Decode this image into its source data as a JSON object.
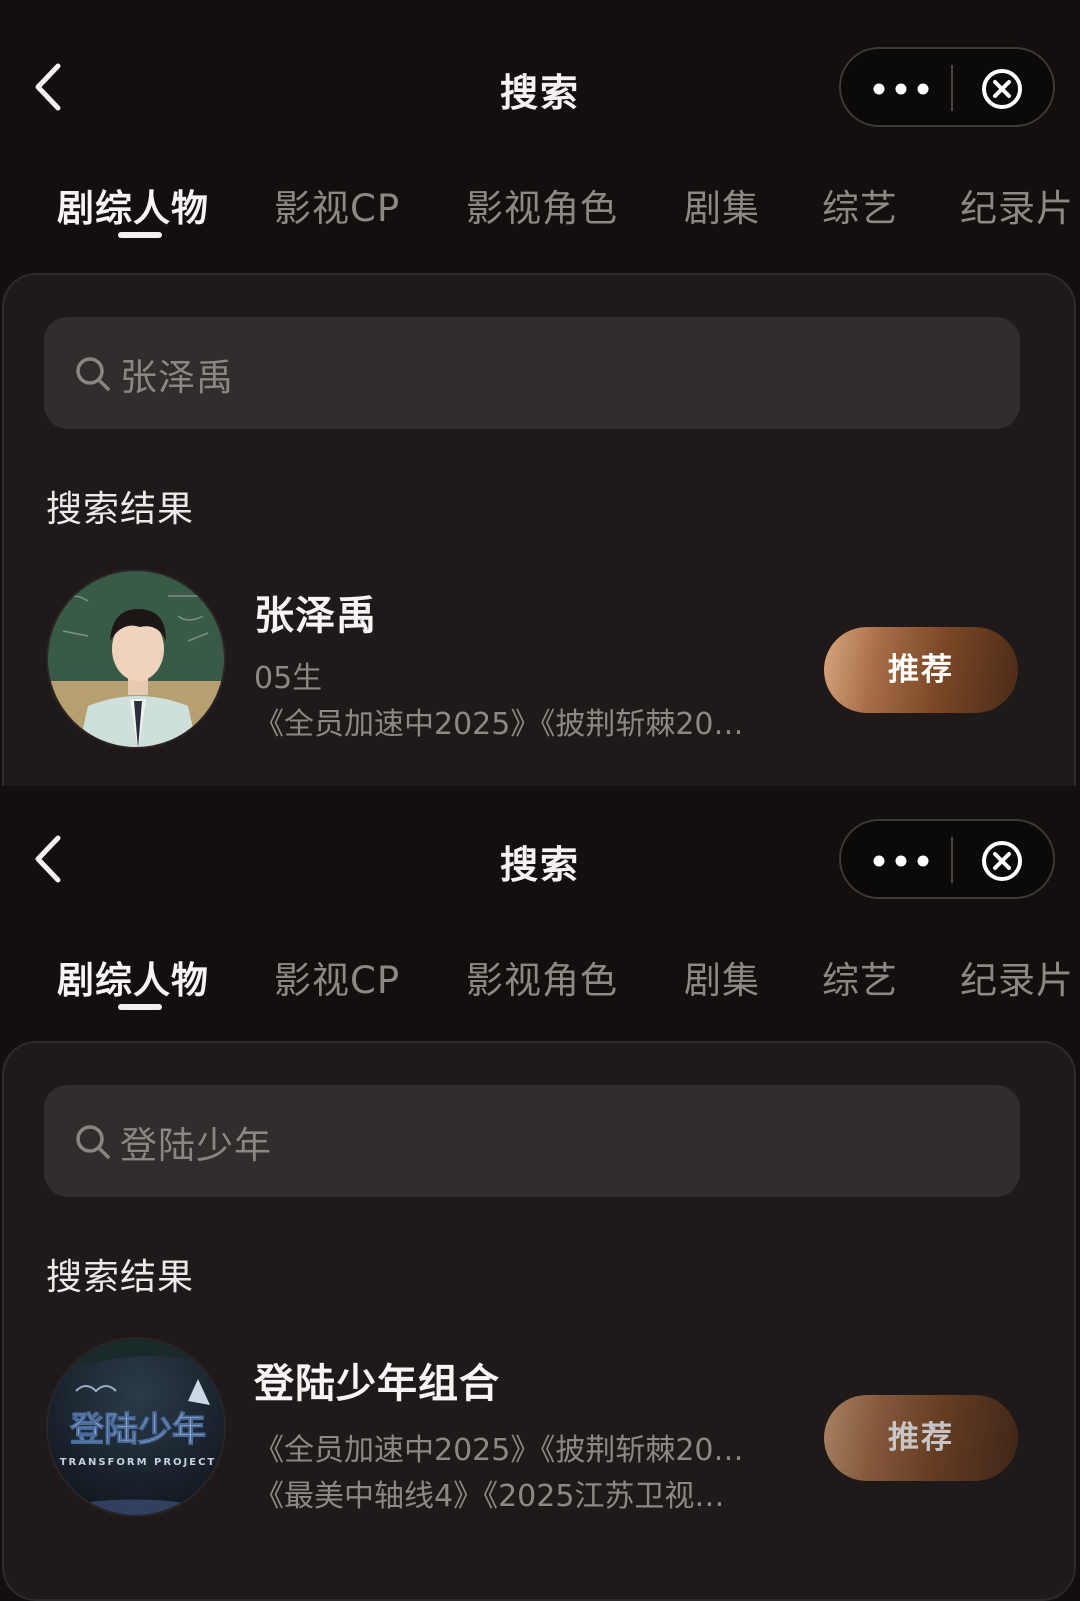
{
  "nav": {
    "title": "搜索",
    "back_icon": "chevron-left-icon",
    "more_icon": "more-dots-icon",
    "close_icon": "close-circle-icon"
  },
  "tabs": [
    {
      "label": "剧综人物",
      "active": true
    },
    {
      "label": "影视CP",
      "active": false
    },
    {
      "label": "影视角色",
      "active": false
    },
    {
      "label": "剧集",
      "active": false
    },
    {
      "label": "综艺",
      "active": false
    },
    {
      "label": "纪录片",
      "active": false
    }
  ],
  "colors": {
    "background": "#140f0f",
    "panel": "#1f1a19",
    "search_box": "#322d2c",
    "button_gradient_light": "#d8a67f",
    "button_gradient_dark": "#4a2a18"
  },
  "screens": [
    {
      "search": {
        "query": "张泽禹"
      },
      "section_label": "搜索结果",
      "result": {
        "name": "张泽禹",
        "line1": "05生",
        "line2": "《全员加速中2025》《披荆斩棘20…",
        "button": "推荐"
      }
    },
    {
      "search": {
        "query": "登陆少年"
      },
      "section_label": "搜索结果",
      "result": {
        "name": "登陆少年组合",
        "line1": "《全员加速中2025》《披荆斩棘20…",
        "line2": "《最美中轴线4》《2025江苏卫视…",
        "button": "推荐",
        "logo_text": "登陆少年",
        "logo_subtext": "TRANSFORM PROJECT"
      }
    }
  ]
}
